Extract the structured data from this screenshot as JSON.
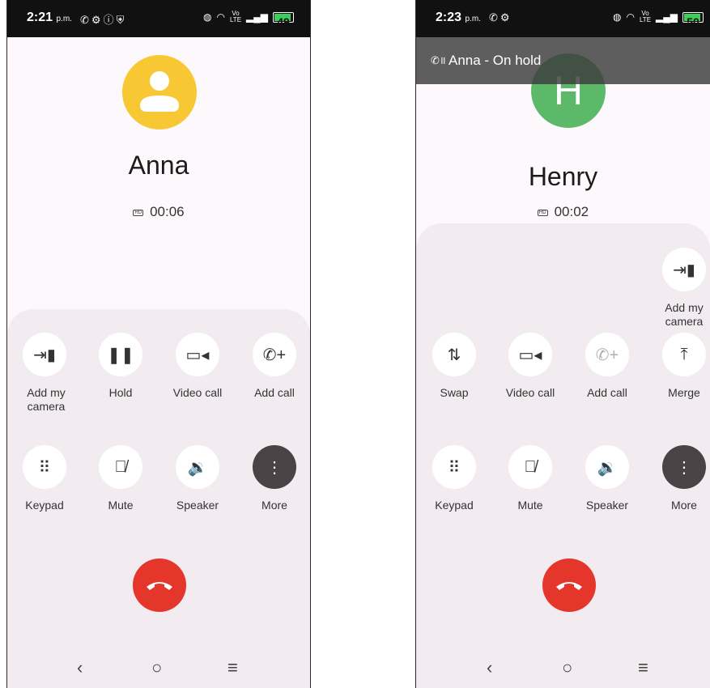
{
  "screen1": {
    "status": {
      "time": "2:21",
      "ampm": "p.m.",
      "battery": "49"
    },
    "contact_name": "Anna",
    "timer": "00:06",
    "hd_label": "HD",
    "buttons": [
      {
        "label": "Add my camera",
        "icon": "camera-switch-icon"
      },
      {
        "label": "Hold",
        "icon": "pause-icon"
      },
      {
        "label": "Video call",
        "icon": "video-icon"
      },
      {
        "label": "Add call",
        "icon": "add-call-icon"
      },
      {
        "label": "Keypad",
        "icon": "keypad-icon"
      },
      {
        "label": "Mute",
        "icon": "mic-off-icon"
      },
      {
        "label": "Speaker",
        "icon": "speaker-icon"
      },
      {
        "label": "More",
        "icon": "more-vert-icon"
      }
    ]
  },
  "screen2": {
    "status": {
      "time": "2:23",
      "ampm": "p.m.",
      "battery": "50"
    },
    "hold_banner": "Anna - On hold",
    "avatar_letter": "H",
    "contact_name": "Henry",
    "timer": "00:02",
    "hd_label": "HD",
    "buttons": [
      {
        "label": "Add my camera",
        "icon": "camera-switch-icon"
      },
      {
        "label": "Swap",
        "icon": "swap-icon"
      },
      {
        "label": "Video call",
        "icon": "video-icon"
      },
      {
        "label": "Add call",
        "icon": "add-call-icon"
      },
      {
        "label": "Merge",
        "icon": "merge-icon"
      },
      {
        "label": "Keypad",
        "icon": "keypad-icon"
      },
      {
        "label": "Mute",
        "icon": "mic-off-icon"
      },
      {
        "label": "Speaker",
        "icon": "speaker-icon"
      },
      {
        "label": "More",
        "icon": "more-vert-icon"
      }
    ]
  },
  "colors": {
    "avatar_anna": "#f7c833",
    "avatar_henry": "#5cb96a",
    "end_call": "#e5362c"
  }
}
